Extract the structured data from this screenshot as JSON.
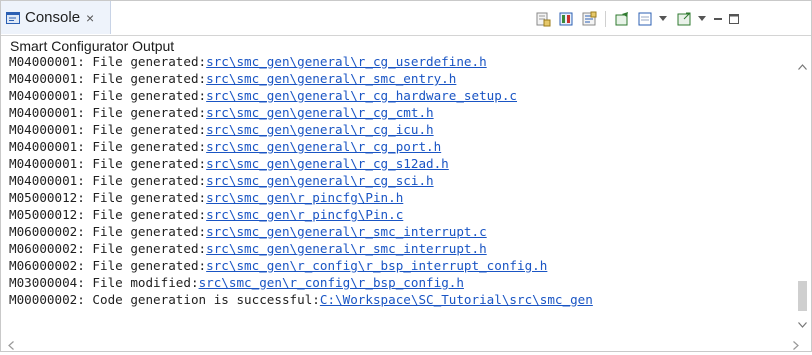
{
  "tab": {
    "label": "Console",
    "close": "×"
  },
  "panel_title": "Smart Configurator Output",
  "lines": [
    {
      "prefix": "M04000001: File generated:",
      "link": "src\\smc_gen\\general\\r_cg_userdefine.h"
    },
    {
      "prefix": "M04000001: File generated:",
      "link": "src\\smc_gen\\general\\r_smc_entry.h"
    },
    {
      "prefix": "M04000001: File generated:",
      "link": "src\\smc_gen\\general\\r_cg_hardware_setup.c"
    },
    {
      "prefix": "M04000001: File generated:",
      "link": "src\\smc_gen\\general\\r_cg_cmt.h"
    },
    {
      "prefix": "M04000001: File generated:",
      "link": "src\\smc_gen\\general\\r_cg_icu.h"
    },
    {
      "prefix": "M04000001: File generated:",
      "link": "src\\smc_gen\\general\\r_cg_port.h"
    },
    {
      "prefix": "M04000001: File generated:",
      "link": "src\\smc_gen\\general\\r_cg_s12ad.h"
    },
    {
      "prefix": "M04000001: File generated:",
      "link": "src\\smc_gen\\general\\r_cg_sci.h"
    },
    {
      "prefix": "M05000012: File generated:",
      "link": "src\\smc_gen\\r_pincfg\\Pin.h"
    },
    {
      "prefix": "M05000012: File generated:",
      "link": "src\\smc_gen\\r_pincfg\\Pin.c"
    },
    {
      "prefix": "M06000002: File generated:",
      "link": "src\\smc_gen\\general\\r_smc_interrupt.c"
    },
    {
      "prefix": "M06000002: File generated:",
      "link": "src\\smc_gen\\general\\r_smc_interrupt.h"
    },
    {
      "prefix": "M06000002: File generated:",
      "link": "src\\smc_gen\\r_config\\r_bsp_interrupt_config.h"
    },
    {
      "prefix": "M03000004: File modified:",
      "link": "src\\smc_gen\\r_config\\r_bsp_config.h"
    },
    {
      "prefix": "M00000002: Code generation is successful:",
      "link": "C:\\Workspace\\SC_Tutorial\\src\\smc_gen"
    }
  ],
  "toolbar_icons": [
    "clear-console-icon",
    "scroll-lock-icon",
    "word-wrap-icon",
    "pin-console-icon",
    "display-selected-console-icon",
    "open-console-icon",
    "minimize-icon",
    "maximize-icon"
  ],
  "colors": {
    "link": "#1a55c4",
    "tab_bg": "#eef3fb"
  }
}
